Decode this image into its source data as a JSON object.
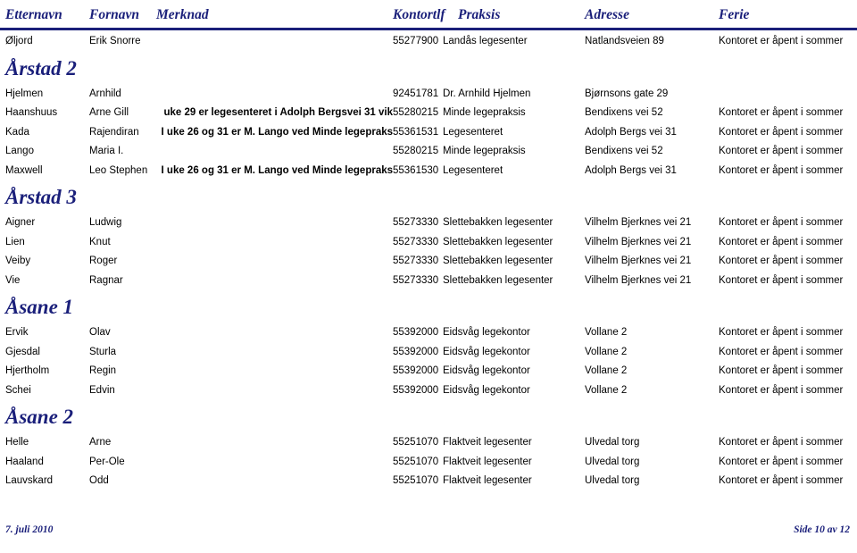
{
  "document": {
    "title": "Legevakt / fastlege liste",
    "accent_color": "#1a1f7a",
    "text_color": "#000000",
    "background": "#ffffff"
  },
  "table_header": {
    "etternavn": "Etternavn",
    "fornavn": "Fornavn",
    "merknad": "Merknad",
    "kontortlf": "Kontortlf",
    "praksis": "Praksis",
    "adresse": "Adresse",
    "ferie": "Ferie"
  },
  "top_rows": [
    {
      "etternavn": "Øljord",
      "fornavn": "Erik Snorre",
      "merknad": "",
      "kontortlf": "55277900",
      "praksis": "Landås legesenter",
      "adresse": "Natlandsveien 89",
      "ferie": "Kontoret er åpent i sommer"
    }
  ],
  "sections": [
    {
      "title": "Årstad 2",
      "rows": [
        {
          "etternavn": "Hjelmen",
          "fornavn": "Arnhild",
          "merknad": "",
          "kontortlf": "92451781",
          "praksis": "Dr. Arnhild Hjelmen",
          "adresse": "Bjørnsons gate 29",
          "ferie": ""
        },
        {
          "etternavn": "Haanshuus",
          "fornavn": "Arne Gill",
          "merknad": "uke 29 er legesenteret i Adolph Bergsvei 31 vik",
          "kontortlf": "55280215",
          "praksis": "Minde legepraksis",
          "adresse": "Bendixens vei 52",
          "ferie": "Kontoret er åpent i sommer"
        },
        {
          "etternavn": "Kada",
          "fornavn": "Rajendiran",
          "merknad": "I uke 26 og 31 er M. Lango ved Minde legepraks",
          "kontortlf": "55361531",
          "praksis": "Legesenteret",
          "adresse": "Adolph Bergs vei 31",
          "ferie": "Kontoret er åpent i sommer"
        },
        {
          "etternavn": "Lango",
          "fornavn": "Maria I.",
          "merknad": "",
          "kontortlf": "55280215",
          "praksis": "Minde legepraksis",
          "adresse": "Bendixens vei 52",
          "ferie": "Kontoret er åpent i sommer"
        },
        {
          "etternavn": "Maxwell",
          "fornavn": "Leo Stephen",
          "merknad": "I uke 26 og 31 er M. Lango ved Minde legepraks",
          "kontortlf": "55361530",
          "praksis": "Legesenteret",
          "adresse": "Adolph Bergs vei 31",
          "ferie": "Kontoret er åpent i sommer"
        }
      ]
    },
    {
      "title": "Årstad 3",
      "rows": [
        {
          "etternavn": "Aigner",
          "fornavn": "Ludwig",
          "merknad": "",
          "kontortlf": "55273330",
          "praksis": "Slettebakken legesenter",
          "adresse": "Vilhelm Bjerknes vei 21",
          "ferie": "Kontoret er åpent i sommer"
        },
        {
          "etternavn": "Lien",
          "fornavn": "Knut",
          "merknad": "",
          "kontortlf": "55273330",
          "praksis": "Slettebakken legesenter",
          "adresse": "Vilhelm Bjerknes vei 21",
          "ferie": "Kontoret er åpent i sommer"
        },
        {
          "etternavn": "Veiby",
          "fornavn": "Roger",
          "merknad": "",
          "kontortlf": "55273330",
          "praksis": "Slettebakken legesenter",
          "adresse": "Vilhelm Bjerknes vei 21",
          "ferie": "Kontoret er åpent i sommer"
        },
        {
          "etternavn": "Vie",
          "fornavn": "Ragnar",
          "merknad": "",
          "kontortlf": "55273330",
          "praksis": "Slettebakken legesenter",
          "adresse": "Vilhelm Bjerknes vei 21",
          "ferie": "Kontoret er åpent i sommer"
        }
      ]
    },
    {
      "title": "Åsane 1",
      "rows": [
        {
          "etternavn": "Ervik",
          "fornavn": "Olav",
          "merknad": "",
          "kontortlf": "55392000",
          "praksis": "Eidsvåg legekontor",
          "adresse": "Vollane 2",
          "ferie": "Kontoret er åpent i sommer"
        },
        {
          "etternavn": "Gjesdal",
          "fornavn": "Sturla",
          "merknad": "",
          "kontortlf": "55392000",
          "praksis": "Eidsvåg legekontor",
          "adresse": "Vollane 2",
          "ferie": "Kontoret er åpent i sommer"
        },
        {
          "etternavn": "Hjertholm",
          "fornavn": "Regin",
          "merknad": "",
          "kontortlf": "55392000",
          "praksis": "Eidsvåg legekontor",
          "adresse": "Vollane 2",
          "ferie": "Kontoret er åpent i sommer"
        },
        {
          "etternavn": "Schei",
          "fornavn": "Edvin",
          "merknad": "",
          "kontortlf": "55392000",
          "praksis": "Eidsvåg legekontor",
          "adresse": "Vollane 2",
          "ferie": "Kontoret er åpent i sommer"
        }
      ]
    },
    {
      "title": "Åsane 2",
      "rows": [
        {
          "etternavn": "Helle",
          "fornavn": "Arne",
          "merknad": "",
          "kontortlf": "55251070",
          "praksis": "Flaktveit legesenter",
          "adresse": "Ulvedal torg",
          "ferie": "Kontoret er åpent i sommer"
        },
        {
          "etternavn": "Haaland",
          "fornavn": "Per-Ole",
          "merknad": "",
          "kontortlf": "55251070",
          "praksis": "Flaktveit legesenter",
          "adresse": "Ulvedal torg",
          "ferie": "Kontoret er åpent i sommer"
        },
        {
          "etternavn": "Lauvskard",
          "fornavn": "Odd",
          "merknad": "",
          "kontortlf": "55251070",
          "praksis": "Flaktveit legesenter",
          "adresse": "Ulvedal torg",
          "ferie": "Kontoret er åpent i sommer"
        }
      ]
    }
  ],
  "footer": {
    "date": "7. juli 2010",
    "page": "Side 10 av 12"
  }
}
